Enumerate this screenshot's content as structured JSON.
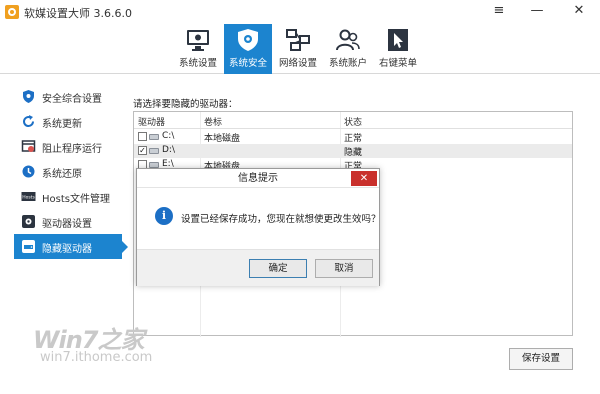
{
  "app": {
    "title": "软媒设置大师 3.6.6.0"
  },
  "window_controls": {
    "menu": "≡",
    "minimize": "—",
    "close": "✕"
  },
  "toolbar": {
    "tabs": [
      {
        "label": "系统设置",
        "icon": "monitor-gear-icon",
        "active": false
      },
      {
        "label": "系统安全",
        "icon": "shield-gear-icon",
        "active": true
      },
      {
        "label": "网络设置",
        "icon": "network-icon",
        "active": false
      },
      {
        "label": "系统账户",
        "icon": "users-icon",
        "active": false
      },
      {
        "label": "右键菜单",
        "icon": "cursor-menu-icon",
        "active": false
      }
    ]
  },
  "sidebar": {
    "items": [
      {
        "label": "安全综合设置",
        "icon": "shield-icon",
        "active": false
      },
      {
        "label": "系统更新",
        "icon": "refresh-icon",
        "active": false
      },
      {
        "label": "阻止程序运行",
        "icon": "block-program-icon",
        "active": false
      },
      {
        "label": "系统还原",
        "icon": "restore-icon",
        "active": false
      },
      {
        "label": "Hosts文件管理",
        "icon": "hosts-icon",
        "active": false
      },
      {
        "label": "驱动器设置",
        "icon": "drive-settings-icon",
        "active": false
      },
      {
        "label": "隐藏驱动器",
        "icon": "hide-drive-icon",
        "active": true
      }
    ]
  },
  "main": {
    "prompt": "请选择要隐藏的驱动器：",
    "table": {
      "headers": [
        "驱动器",
        "卷标",
        "状态"
      ],
      "rows": [
        {
          "drive": "C:\\",
          "label": "本地磁盘",
          "status": "正常",
          "checked": false,
          "selected": false
        },
        {
          "drive": "D:\\",
          "label": "",
          "status": "隐藏",
          "checked": true,
          "selected": true
        },
        {
          "drive": "E:\\",
          "label": "本地磁盘",
          "status": "正常",
          "checked": false,
          "selected": false
        }
      ]
    },
    "save_button": "保存设置"
  },
  "dialog": {
    "title": "信息提示",
    "close": "✕",
    "message": "设置已经保存成功，您现在就想使更改生效吗？",
    "confirm": "确定",
    "cancel": "取消"
  },
  "watermark": {
    "logo": "Win7之家",
    "url": "win7.ithome.com"
  },
  "colors": {
    "accent": "#1c84cf",
    "close_red": "#c9302c",
    "info_blue": "#1c6fc5"
  }
}
